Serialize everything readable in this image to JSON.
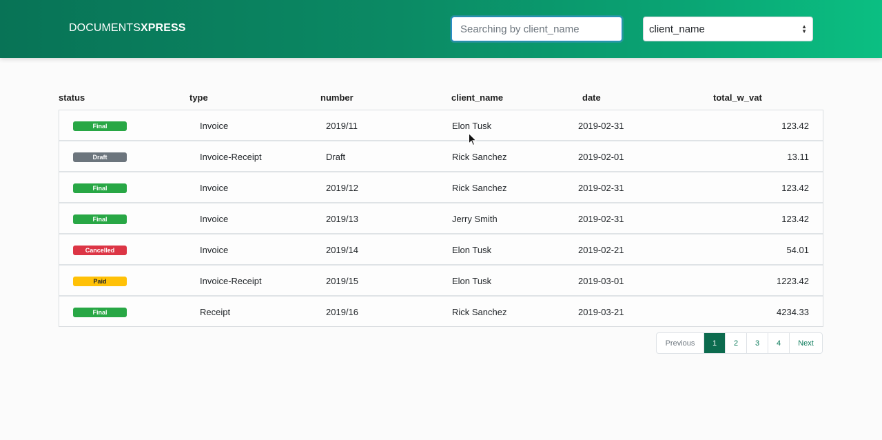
{
  "brand": {
    "part1": "DOCUMENTS",
    "part2": "XPRESS"
  },
  "search": {
    "placeholder": "Searching by client_name",
    "value": ""
  },
  "filter_select": {
    "selected": "client_name"
  },
  "columns": [
    "status",
    "type",
    "number",
    "client_name",
    "date",
    "total_w_vat"
  ],
  "rows": [
    {
      "status": "Final",
      "type": "Invoice",
      "number": "2019/11",
      "client_name": "Elon Tusk",
      "date": "2019-02-31",
      "total": "123.42"
    },
    {
      "status": "Draft",
      "type": "Invoice-Receipt",
      "number": "Draft",
      "client_name": "Rick Sanchez",
      "date": "2019-02-01",
      "total": "13.11"
    },
    {
      "status": "Final",
      "type": "Invoice",
      "number": "2019/12",
      "client_name": "Rick Sanchez",
      "date": "2019-02-31",
      "total": "123.42"
    },
    {
      "status": "Final",
      "type": "Invoice",
      "number": "2019/13",
      "client_name": "Jerry Smith",
      "date": "2019-02-31",
      "total": "123.42"
    },
    {
      "status": "Cancelled",
      "type": "Invoice",
      "number": "2019/14",
      "client_name": "Elon Tusk",
      "date": "2019-02-21",
      "total": "54.01"
    },
    {
      "status": "Paid",
      "type": "Invoice-Receipt",
      "number": "2019/15",
      "client_name": "Elon Tusk",
      "date": "2019-03-01",
      "total": "1223.42"
    },
    {
      "status": "Final",
      "type": "Receipt",
      "number": "2019/16",
      "client_name": "Rick Sanchez",
      "date": "2019-03-21",
      "total": "4234.33"
    }
  ],
  "status_colors": {
    "Final": "#28a745",
    "Draft": "#6c757d",
    "Cancelled": "#dc3545",
    "Paid": "#ffc107"
  },
  "pagination": {
    "previous": "Previous",
    "pages": [
      "1",
      "2",
      "3",
      "4"
    ],
    "active": "1",
    "next": "Next"
  },
  "colors": {
    "header_start": "#087356",
    "header_end": "#0bbf82",
    "active_page": "#0c6b4e"
  }
}
